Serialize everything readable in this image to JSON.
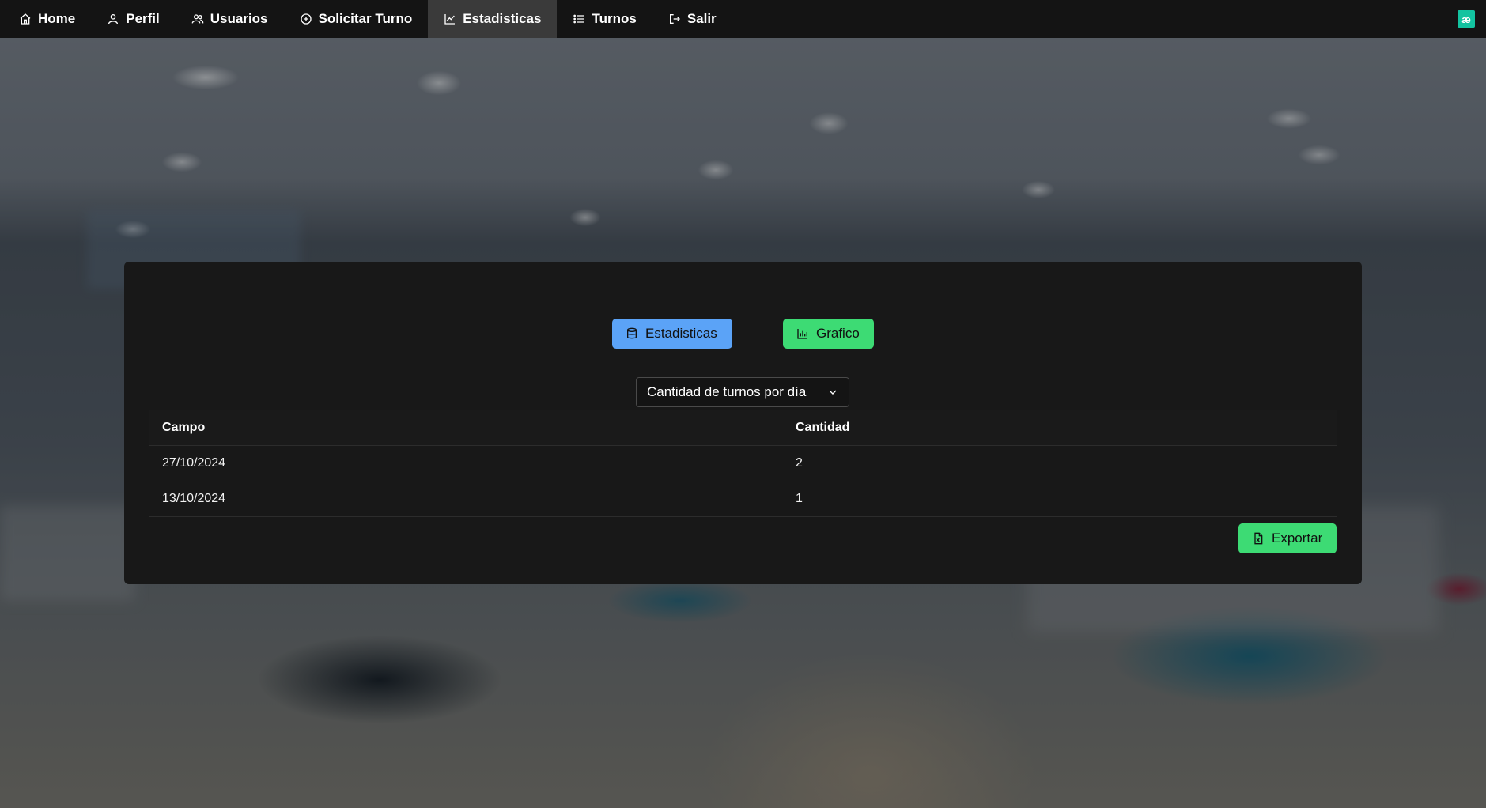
{
  "nav": {
    "items": [
      {
        "label": "Home",
        "icon": "home-icon"
      },
      {
        "label": "Perfil",
        "icon": "user-icon"
      },
      {
        "label": "Usuarios",
        "icon": "users-icon"
      },
      {
        "label": "Solicitar Turno",
        "icon": "plus-circle-icon"
      },
      {
        "label": "Estadisticas",
        "icon": "chart-line-icon",
        "active": true
      },
      {
        "label": "Turnos",
        "icon": "list-icon"
      },
      {
        "label": "Salir",
        "icon": "logout-icon"
      }
    ],
    "badge": "æ",
    "badge_color": "#13c3a0"
  },
  "card": {
    "stats_button": "Estadisticas",
    "chart_button": "Grafico",
    "select_value": "Cantidad de turnos por día",
    "table": {
      "headers": [
        "Campo",
        "Cantidad"
      ],
      "rows": [
        [
          "27/10/2024",
          "2"
        ],
        [
          "13/10/2024",
          "1"
        ]
      ]
    },
    "export_button": "Exportar"
  },
  "colors": {
    "accent_blue": "#5ba3f7",
    "accent_green": "#3ddb74",
    "card_bg": "#181818",
    "navbar_bg": "#141414"
  }
}
